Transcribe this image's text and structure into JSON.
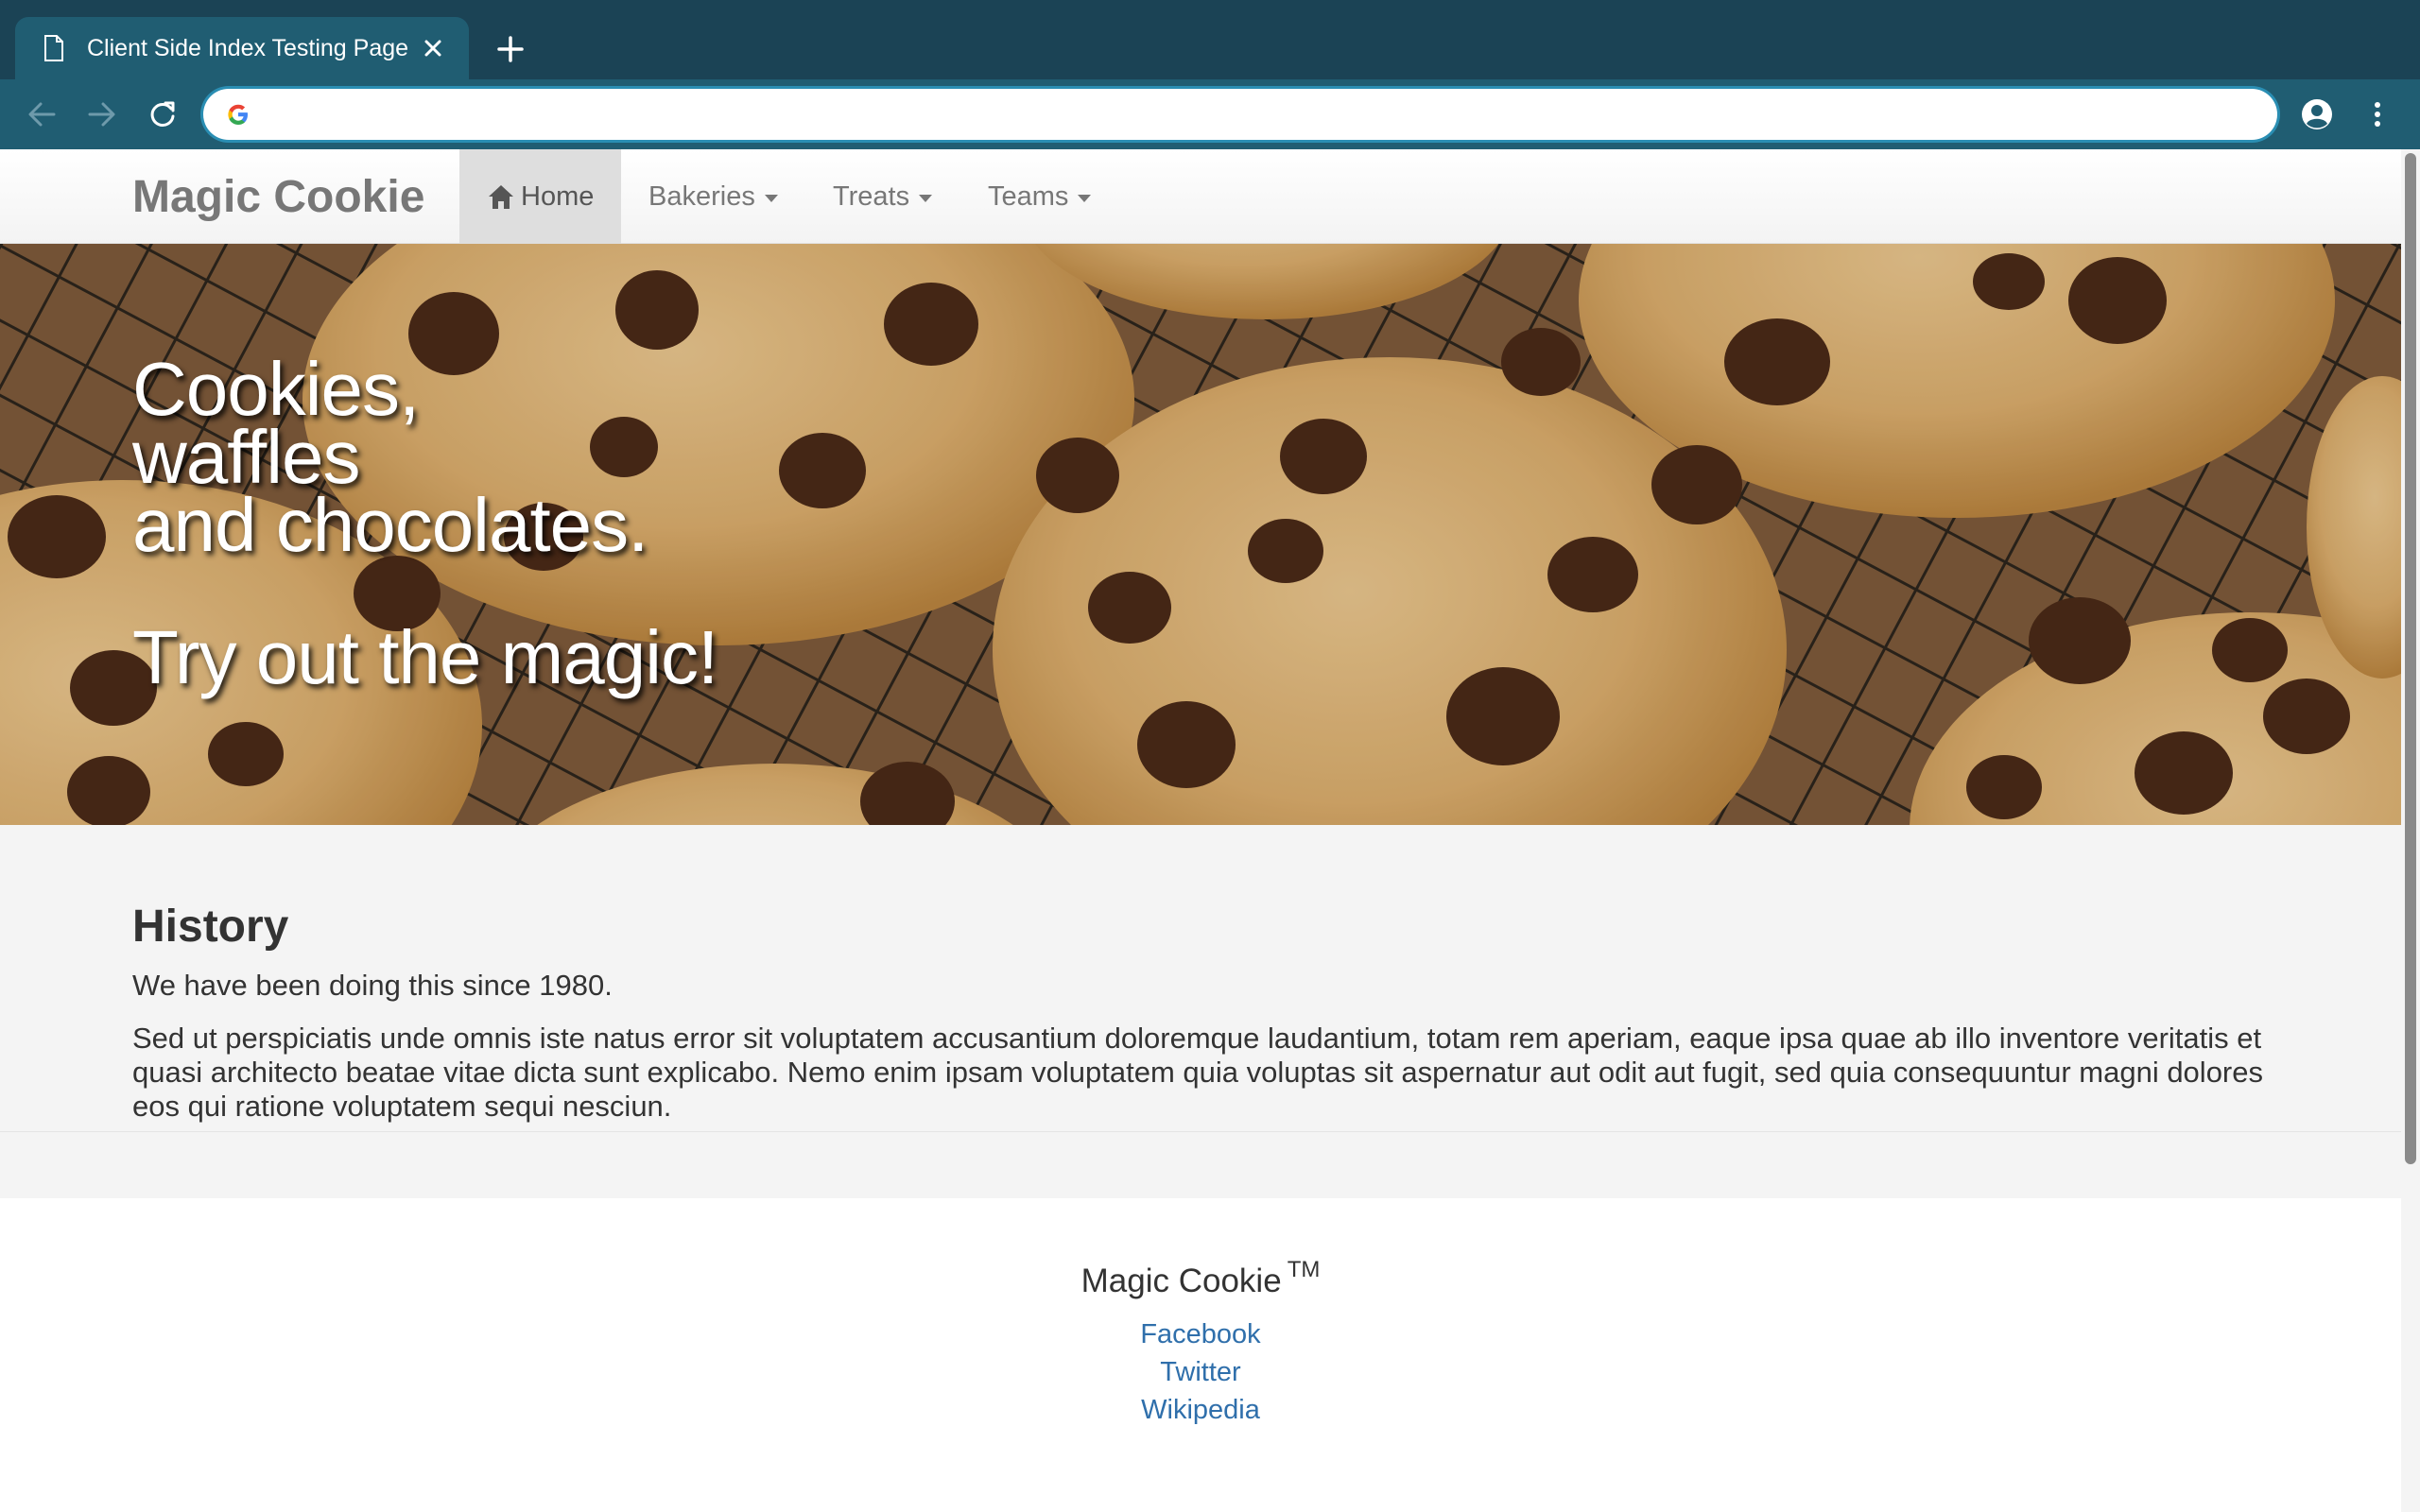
{
  "browser": {
    "tab_title": "Client Side Index Testing Page",
    "address_value": "",
    "address_placeholder": ""
  },
  "navbar": {
    "brand": "Magic Cookie",
    "items": [
      {
        "label": "Home",
        "active": true
      },
      {
        "label": "Bakeries",
        "dropdown": true
      },
      {
        "label": "Treats",
        "dropdown": true
      },
      {
        "label": "Teams",
        "dropdown": true
      }
    ]
  },
  "hero": {
    "lines": [
      "Cookies,",
      "waffles",
      "and chocolates."
    ],
    "tagline": "Try out the magic!"
  },
  "history": {
    "heading": "History",
    "lead": "We have been doing this since 1980.",
    "body": "Sed ut perspiciatis unde omnis iste natus error sit voluptatem accusantium doloremque laudantium, totam rem aperiam, eaque ipsa quae ab illo inventore veritatis et quasi architecto beatae vitae dicta sunt explicabo. Nemo enim ipsam voluptatem quia voluptas sit aspernatur aut odit aut fugit, sed quia consequuntur magni dolores eos qui ratione voluptatem sequi nesciun."
  },
  "footer": {
    "brand": "Magic Cookie",
    "trademark": "TM",
    "links": [
      "Facebook",
      "Twitter",
      "Wikipedia"
    ]
  },
  "colors": {
    "chrome_dark": "#1b4355",
    "chrome_tab": "#205d72",
    "omnibox_ring": "#2a8eb3",
    "link": "#2f6fab",
    "brand_text": "#777777"
  },
  "icons": [
    "document-icon",
    "close-icon",
    "plus-icon",
    "back-arrow-icon",
    "forward-arrow-icon",
    "reload-icon",
    "google-icon",
    "profile-icon",
    "more-vert-icon",
    "home-icon",
    "caret-down-icon"
  ]
}
